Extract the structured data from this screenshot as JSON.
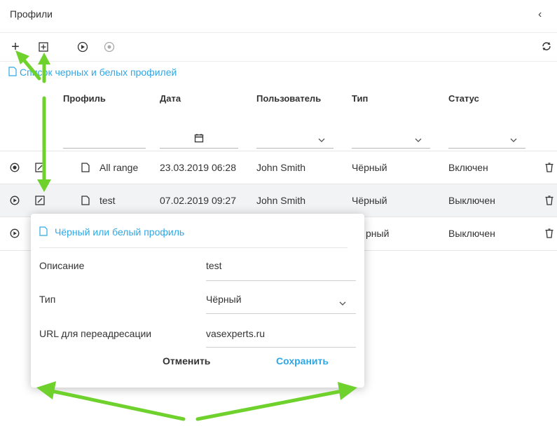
{
  "header": {
    "title": "Профили"
  },
  "links": {
    "profiles_list": "Список черных и белых профилей"
  },
  "table": {
    "columns": [
      "Профиль",
      "Дата",
      "Пользователь",
      "Тип",
      "Статус"
    ],
    "rows": [
      {
        "name": "All range",
        "date": "23.03.2019 06:28",
        "user": "John Smith",
        "type": "Чёрный",
        "status": "Включен"
      },
      {
        "name": "test",
        "date": "07.02.2019 09:27",
        "user": "John Smith",
        "type": "Чёрный",
        "status": "Выключен"
      },
      {
        "type_partial": "рный",
        "status": "Выключен"
      }
    ]
  },
  "popup": {
    "title": "Чёрный или белый профиль",
    "fields": [
      {
        "label": "Описание",
        "value": "test"
      },
      {
        "label": "Тип",
        "value": "Чёрный"
      },
      {
        "label": "URL для переадресации",
        "value": "vasexperts.ru"
      }
    ],
    "cancel_label": "Отменить",
    "save_label": "Сохранить"
  },
  "colors": {
    "accent": "#2ea8e5",
    "arrow": "#6fd12b"
  }
}
